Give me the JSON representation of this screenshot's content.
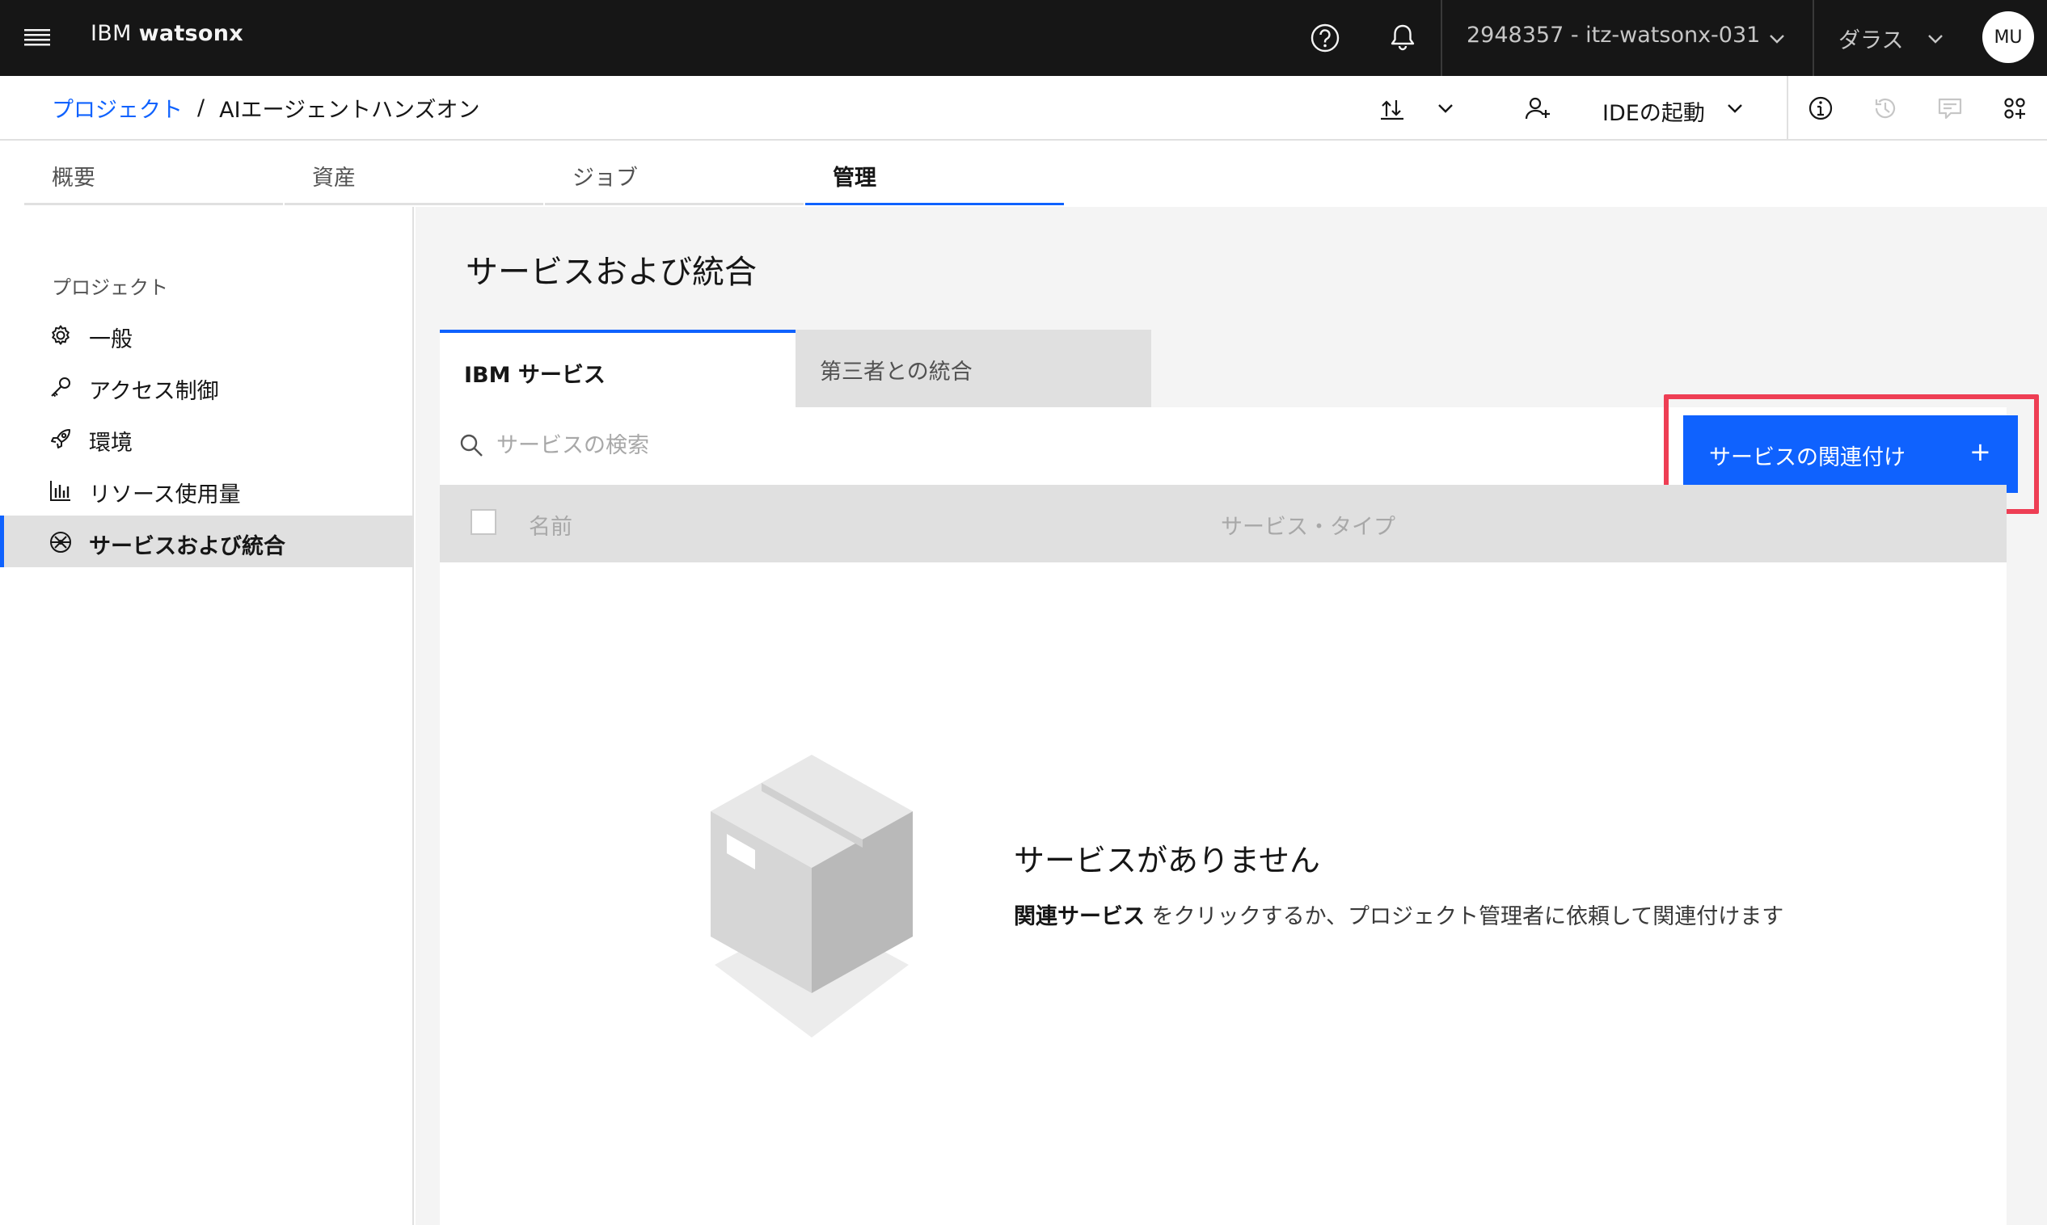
{
  "app": {
    "brand_prefix": "IBM",
    "brand_name": "watsonx",
    "account": "2948357 - itz-watsonx-031",
    "user_region": "ダラス",
    "avatar_initials": "MU"
  },
  "icons": {
    "menu": "hamburger-menu-icon",
    "help": "help-icon",
    "notifications": "bell-icon",
    "chevron": "chevron-down-icon",
    "upload_download": "upload-download-icon",
    "add_collaborator": "add-user-icon",
    "info": "info-icon",
    "history": "history-icon",
    "comments": "chat-icon",
    "apps": "apps-icon",
    "search": "search-icon"
  },
  "breadcrumb": {
    "parent": "プロジェクト",
    "separator": "/",
    "current": "AIエージェントハンズオン"
  },
  "toolbar": {
    "ide_label": "IDEの起動"
  },
  "tabs": [
    {
      "label": "概要",
      "active": false
    },
    {
      "label": "資産",
      "active": false
    },
    {
      "label": "ジョブ",
      "active": false
    },
    {
      "label": "管理",
      "active": true
    }
  ],
  "sidebar": {
    "section_title": "プロジェクト",
    "items": [
      {
        "label": "一般",
        "icon": "gear-icon",
        "active": false
      },
      {
        "label": "アクセス制御",
        "icon": "key-icon",
        "active": false
      },
      {
        "label": "環境",
        "icon": "rocket-icon",
        "active": false
      },
      {
        "label": "リソース使用量",
        "icon": "bar-chart-icon",
        "active": false
      },
      {
        "label": "サービスおよび統合",
        "icon": "integration-icon",
        "active": true
      }
    ]
  },
  "main": {
    "title": "サービスおよび統合",
    "subtabs": [
      {
        "label": "IBM サービス",
        "active": true
      },
      {
        "label": "第三者との統合",
        "active": false
      }
    ],
    "search_placeholder": "サービスの検索",
    "associate_button": "サービスの関連付け",
    "associate_plus": "+",
    "table_headers": [
      "名前",
      "サービス・タイプ"
    ],
    "empty_title": "サービスがありません",
    "empty_desc_bold": "関連サービス",
    "empty_desc_rest": " をクリックするか、プロジェクト管理者に依頼して関連付けます"
  },
  "colors": {
    "topbar": "#161616",
    "accent": "#0f62fe",
    "highlight": "#ee3e54",
    "content_bg": "#f4f4f4"
  }
}
